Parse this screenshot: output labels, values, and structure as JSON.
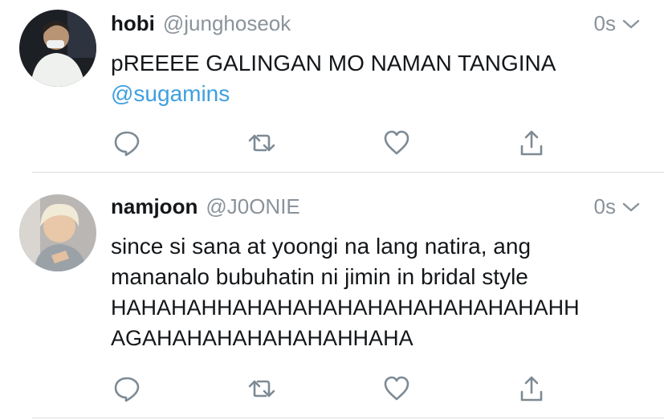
{
  "tweets": [
    {
      "name": "hobi",
      "handle": "@junghoseok",
      "time": "0s",
      "text": "pREEEE GALINGAN MO NAMAN TANGINA",
      "mention": "@sugamins"
    },
    {
      "name": "namjoon",
      "handle": "@J0ONIE",
      "time": "0s",
      "lines": [
        "since si sana at yoongi na lang natira, ang",
        "mananalo bubuhatin ni jimin in bridal style",
        "HAHAHAHHAHAHAHAHAHAHAHAHAHAHAHH",
        "AGAHAHAHAHAHAHAHHAHA"
      ]
    }
  ],
  "icons": [
    "reply-icon",
    "retweet-icon",
    "like-icon",
    "share-icon"
  ],
  "colors": {
    "text": "#14171a",
    "muted": "#8a939b",
    "link": "#3f9fdf",
    "icon": "#7d8a94"
  }
}
